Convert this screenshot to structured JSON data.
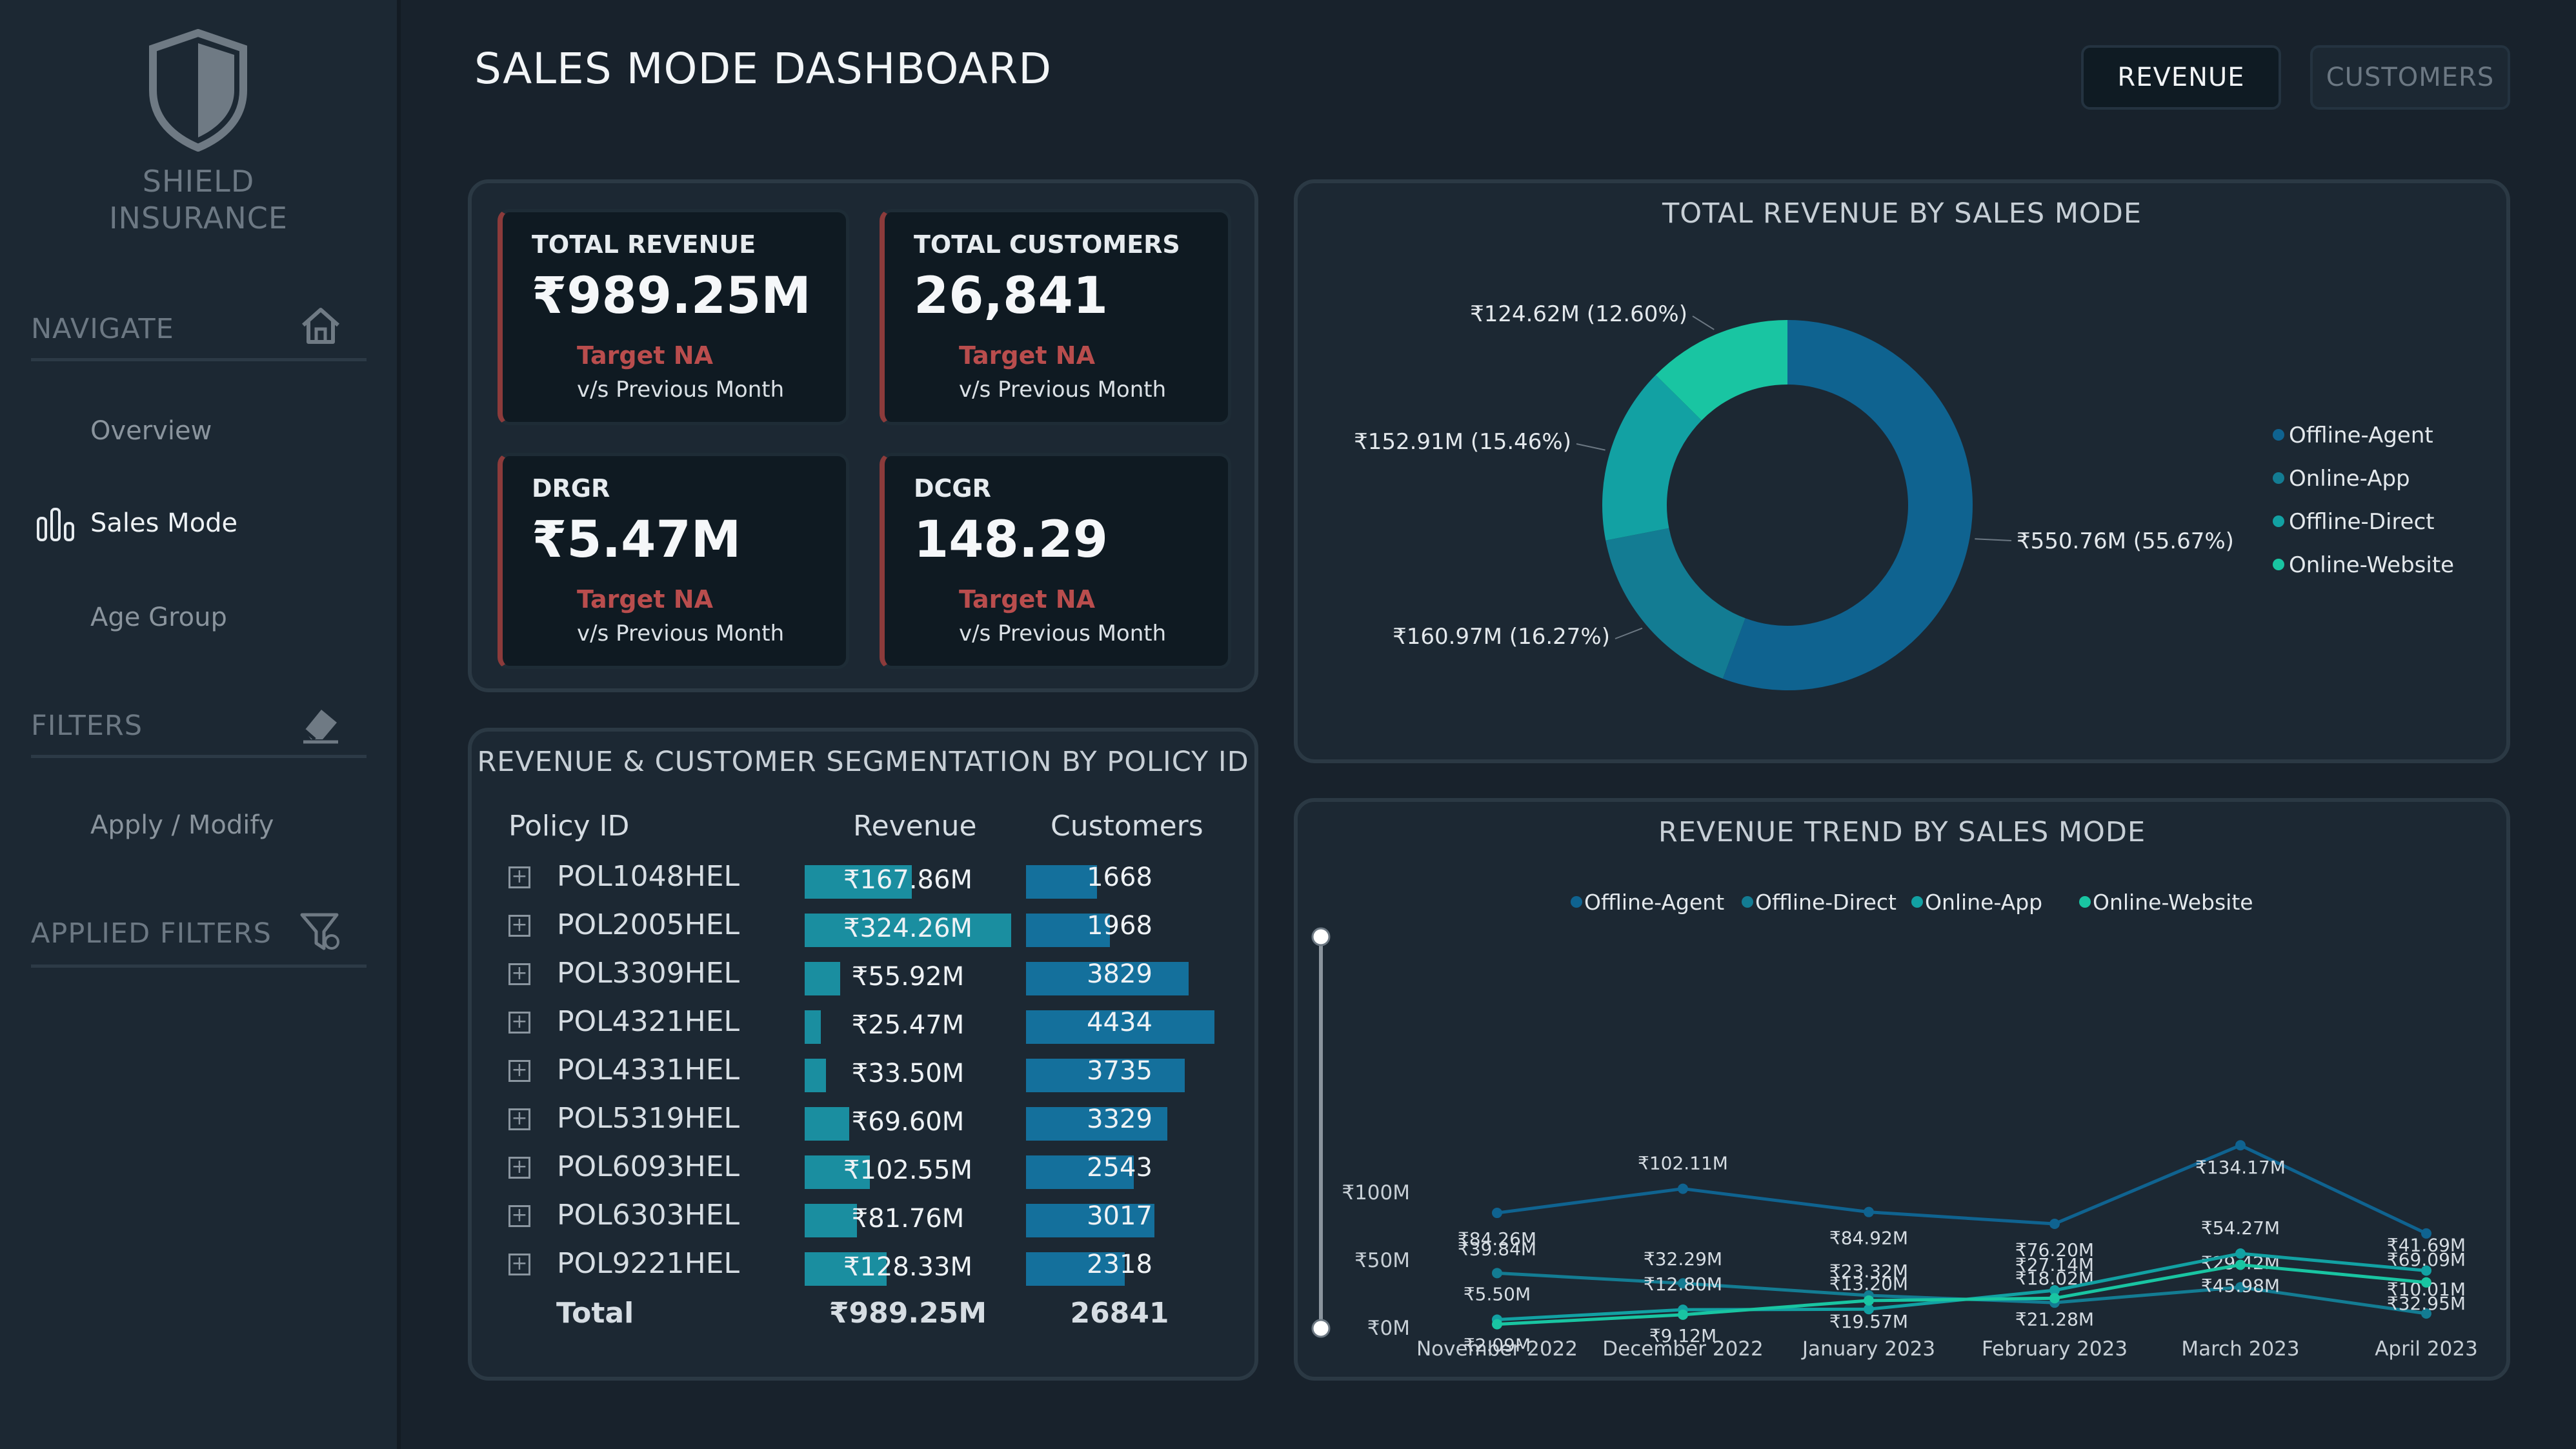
{
  "brand": {
    "line1": "SHIELD",
    "line2": "INSURANCE"
  },
  "sidebar": {
    "navigate_label": "NAVIGATE",
    "nav_items": [
      "Overview",
      "Sales Mode",
      "Age Group"
    ],
    "active_item": "Sales Mode",
    "filters_label": "FILTERS",
    "apply_label": "Apply / Modify",
    "applied_filters_label": "APPLIED FILTERS",
    "icons": {
      "navigate": "home-icon",
      "filters": "eraser-icon",
      "applied": "filter-icon",
      "sales_mode": "bar-chart-icon",
      "logo": "shield-icon"
    }
  },
  "header": {
    "title": "SALES MODE DASHBOARD",
    "revenue_btn": "REVENUE",
    "customers_btn": "CUSTOMERS"
  },
  "kpis": [
    {
      "label": "TOTAL REVENUE",
      "value": "₹989.25M",
      "target": "Target NA",
      "sub": "v/s Previous Month"
    },
    {
      "label": "TOTAL CUSTOMERS",
      "value": "26,841",
      "target": "Target NA",
      "sub": "v/s Previous Month"
    },
    {
      "label": "DRGR",
      "value": "₹5.47M",
      "target": "Target NA",
      "sub": "v/s Previous Month"
    },
    {
      "label": "DCGR",
      "value": "148.29",
      "target": "Target NA",
      "sub": "v/s Previous Month"
    }
  ],
  "table": {
    "title": "REVENUE & CUSTOMER SEGMENTATION BY POLICY ID",
    "headers": [
      "Policy ID",
      "Revenue",
      "Customers"
    ],
    "rows": [
      {
        "id": "POL1048HEL",
        "revenue": "₹167.86M",
        "rev_val": 167.86,
        "customers": "1668",
        "cus_val": 1668
      },
      {
        "id": "POL2005HEL",
        "revenue": "₹324.26M",
        "rev_val": 324.26,
        "customers": "1968",
        "cus_val": 1968
      },
      {
        "id": "POL3309HEL",
        "revenue": "₹55.92M",
        "rev_val": 55.92,
        "customers": "3829",
        "cus_val": 3829
      },
      {
        "id": "POL4321HEL",
        "revenue": "₹25.47M",
        "rev_val": 25.47,
        "customers": "4434",
        "cus_val": 4434
      },
      {
        "id": "POL4331HEL",
        "revenue": "₹33.50M",
        "rev_val": 33.5,
        "customers": "3735",
        "cus_val": 3735
      },
      {
        "id": "POL5319HEL",
        "revenue": "₹69.60M",
        "rev_val": 69.6,
        "customers": "3329",
        "cus_val": 3329
      },
      {
        "id": "POL6093HEL",
        "revenue": "₹102.55M",
        "rev_val": 102.55,
        "customers": "2543",
        "cus_val": 2543
      },
      {
        "id": "POL6303HEL",
        "revenue": "₹81.76M",
        "rev_val": 81.76,
        "customers": "3017",
        "cus_val": 3017
      },
      {
        "id": "POL9221HEL",
        "revenue": "₹128.33M",
        "rev_val": 128.33,
        "customers": "2318",
        "cus_val": 2318
      }
    ],
    "total_label": "Total",
    "total_revenue": "₹989.25M",
    "total_customers": "26841",
    "bar_colors": {
      "revenue": "#1a8ea0",
      "customers": "#14709c"
    }
  },
  "chart_data": [
    {
      "type": "pie",
      "title": "TOTAL REVENUE BY SALES MODE",
      "slices": [
        {
          "name": "Offline-Agent",
          "value": 550.76,
          "label": "₹550.76M (55.67%)",
          "color": "#0f6390"
        },
        {
          "name": "Online-App",
          "value": 160.97,
          "label": "₹160.97M (16.27%)",
          "color": "#137c93"
        },
        {
          "name": "Offline-Direct",
          "value": 152.91,
          "label": "₹152.91M (15.46%)",
          "color": "#12a1a3"
        },
        {
          "name": "Online-Website",
          "value": 124.62,
          "label": "₹124.62M (12.60%)",
          "color": "#19c5a2"
        }
      ],
      "legend": [
        "Offline-Agent",
        "Online-App",
        "Offline-Direct",
        "Online-Website"
      ],
      "legend_position": "right"
    },
    {
      "type": "line",
      "title": "REVENUE TREND BY SALES MODE",
      "categories": [
        "November 2022",
        "December 2022",
        "January 2023",
        "February 2023",
        "March 2023",
        "April 2023"
      ],
      "y_ticks": [
        "₹0M",
        "₹50M",
        "₹100M"
      ],
      "ylim": [
        0,
        140
      ],
      "legend": [
        "Offline-Agent",
        "Offline-Direct",
        "Online-App",
        "Online-Website"
      ],
      "legend_position": "top",
      "series": [
        {
          "name": "Offline-Agent",
          "color": "#0f6390",
          "values": [
            84.26,
            102.11,
            84.92,
            76.2,
            134.17,
            69.09
          ],
          "labels": [
            "₹84.26M",
            "₹102.11M",
            "₹84.92M",
            "₹76.20M",
            "₹134.17M",
            "₹69.09M"
          ]
        },
        {
          "name": "Offline-Direct",
          "color": "#137c93",
          "values": [
            39.84,
            32.29,
            23.32,
            18.02,
            29.42,
            10.01
          ],
          "labels": [
            "₹39.84M",
            "₹32.29M",
            "₹23.32M",
            "₹18.02M",
            "₹29.42M",
            "₹10.01M"
          ]
        },
        {
          "name": "Online-App",
          "color": "#12a1a3",
          "values": [
            5.5,
            12.8,
            13.2,
            27.14,
            54.27,
            41.69
          ],
          "labels": [
            "₹5.50M",
            "₹12.80M",
            "₹13.20M",
            "₹27.14M",
            "₹54.27M",
            "₹41.69M"
          ]
        },
        {
          "name": "Online-Website",
          "color": "#19c5a2",
          "values": [
            2.09,
            9.12,
            19.57,
            21.28,
            45.98,
            32.95
          ],
          "labels": [
            "₹2.09M",
            "₹9.12M",
            "₹19.57M",
            "₹21.28M",
            "₹45.98M",
            "₹32.95M"
          ]
        }
      ]
    }
  ]
}
